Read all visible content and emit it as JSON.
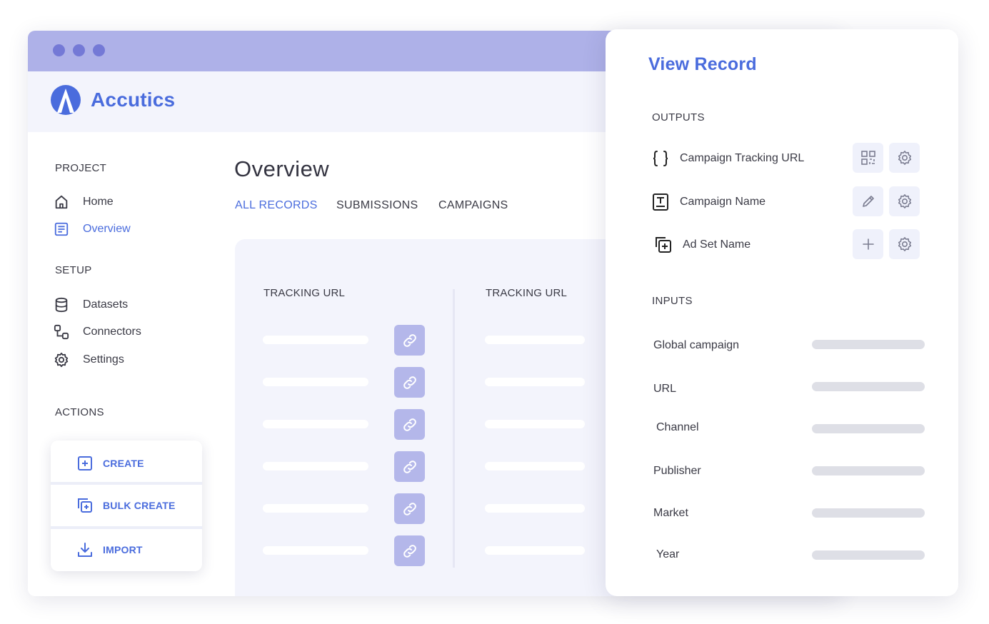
{
  "brand": {
    "name": "Accutics",
    "color": "#4a6cdd"
  },
  "sidebar": {
    "project_label": "PROJECT",
    "project_items": [
      {
        "label": "Home",
        "icon": "home-icon"
      },
      {
        "label": "Overview",
        "icon": "overview-icon",
        "active": true
      }
    ],
    "setup_label": "SETUP",
    "setup_items": [
      {
        "label": "Datasets",
        "icon": "database-icon"
      },
      {
        "label": "Connectors",
        "icon": "connectors-icon"
      },
      {
        "label": "Settings",
        "icon": "gear-icon"
      }
    ],
    "actions_label": "ACTIONS",
    "actions": [
      {
        "label": "CREATE",
        "icon": "plus-square-icon"
      },
      {
        "label": "BULK CREATE",
        "icon": "bulk-create-icon"
      },
      {
        "label": "IMPORT",
        "icon": "download-icon"
      }
    ]
  },
  "main": {
    "title": "Overview",
    "tabs": [
      {
        "label": "ALL RECORDS",
        "active": true
      },
      {
        "label": "SUBMISSIONS"
      },
      {
        "label": "CAMPAIGNS"
      }
    ],
    "columns": [
      {
        "label": "TRACKING URL"
      },
      {
        "label": "TRACKING URL"
      }
    ]
  },
  "record_panel": {
    "title": "View Record",
    "outputs_label": "OUTPUTS",
    "outputs": [
      {
        "label": "Campaign Tracking URL",
        "icon": "code-braces-icon",
        "action_icon": "qr-code-icon"
      },
      {
        "label": "Campaign Name",
        "icon": "text-box-icon",
        "action_icon": "pencil-icon"
      },
      {
        "label": "Ad Set Name",
        "icon": "bulk-add-icon",
        "action_icon": "plus-icon"
      }
    ],
    "inputs_label": "INPUTS",
    "inputs": [
      {
        "label": "Global campaign"
      },
      {
        "label": "URL"
      },
      {
        "label": "Channel"
      },
      {
        "label": "Publisher"
      },
      {
        "label": "Market"
      },
      {
        "label": "Year"
      }
    ]
  },
  "colors": {
    "accent": "#4a6cdd",
    "titlebar": "#aeb1e8",
    "window_dots": "#7479d6",
    "link_button": "#b4b7ea",
    "panel_bg": "#f3f4fc"
  }
}
